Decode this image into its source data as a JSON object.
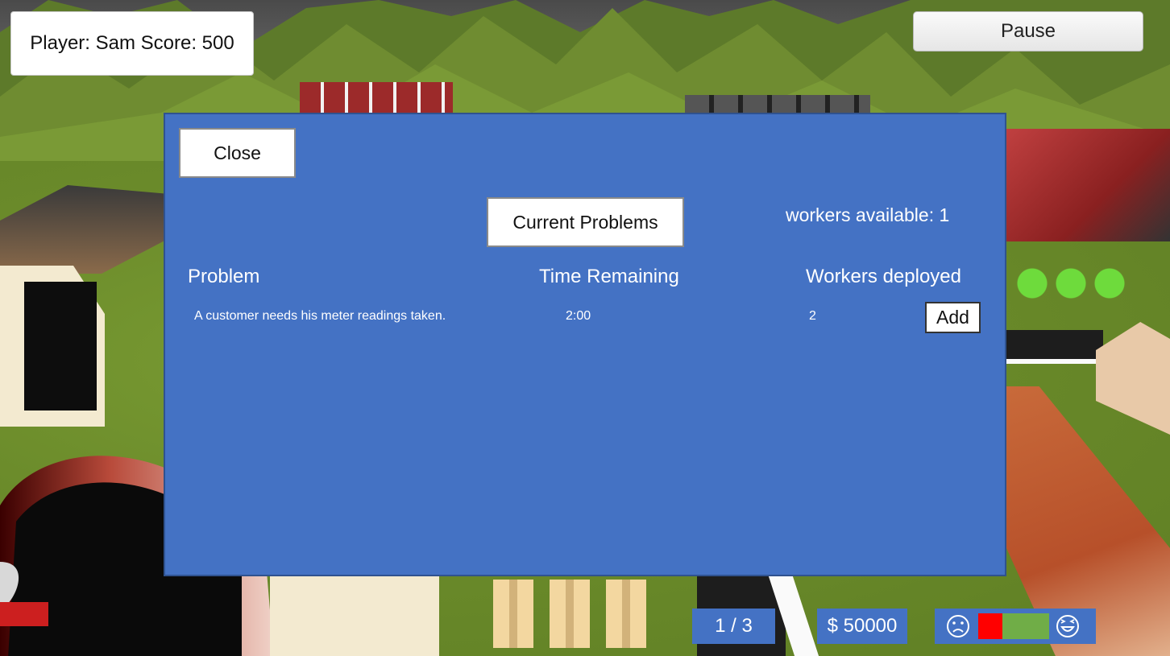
{
  "hud": {
    "player_score": "Player: Sam Score: 500",
    "pause_label": "Pause",
    "page_indicator": "1 / 3",
    "money": "$ 50000",
    "happiness": {
      "sad_icon": "sad-face-icon",
      "happy_icon": "laughing-face-icon",
      "level": 0.68,
      "negative_color": "#ff0000",
      "positive_color": "#70ad47"
    }
  },
  "problems_panel": {
    "close_label": "Close",
    "title": "Current Problems",
    "workers_available": "workers available: 1",
    "columns": [
      "Problem",
      "Time Remaining",
      "Workers deployed"
    ],
    "rows": [
      {
        "problem": "A customer needs his meter readings taken.",
        "time_remaining": "2:00",
        "workers_deployed": "2",
        "action_label": "Add"
      }
    ],
    "panel_color": "#4472c4"
  }
}
